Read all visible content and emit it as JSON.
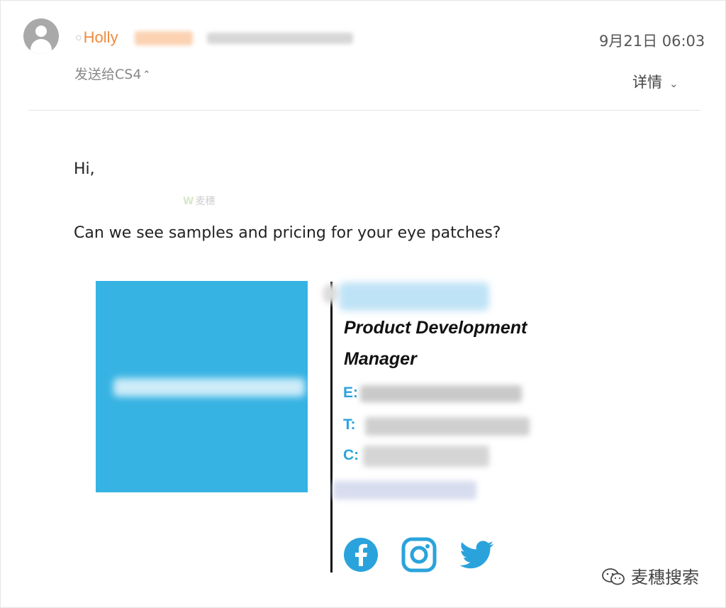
{
  "header": {
    "sender_name": "Holly",
    "date": "9月21日 06:03",
    "recipient": "发送给CS4",
    "recipient_caret": "⌃",
    "details_label": "详情",
    "details_chevron": "⌄"
  },
  "message": {
    "greeting": "Hi,",
    "body": "Can we see samples and pricing for your eye patches?"
  },
  "inline_watermark": {
    "mark": "W",
    "text": "麦穗"
  },
  "signature": {
    "title_line1": "Product Development",
    "title_line2": "Manager",
    "email_label": "E:",
    "phone_label": "T:",
    "cell_label": "C:",
    "social": [
      "facebook-icon",
      "instagram-icon",
      "twitter-icon"
    ],
    "accent_color": "#2aa3dc",
    "logo_color": "#37b3e3"
  },
  "watermark": {
    "text": "麦穗搜索"
  }
}
